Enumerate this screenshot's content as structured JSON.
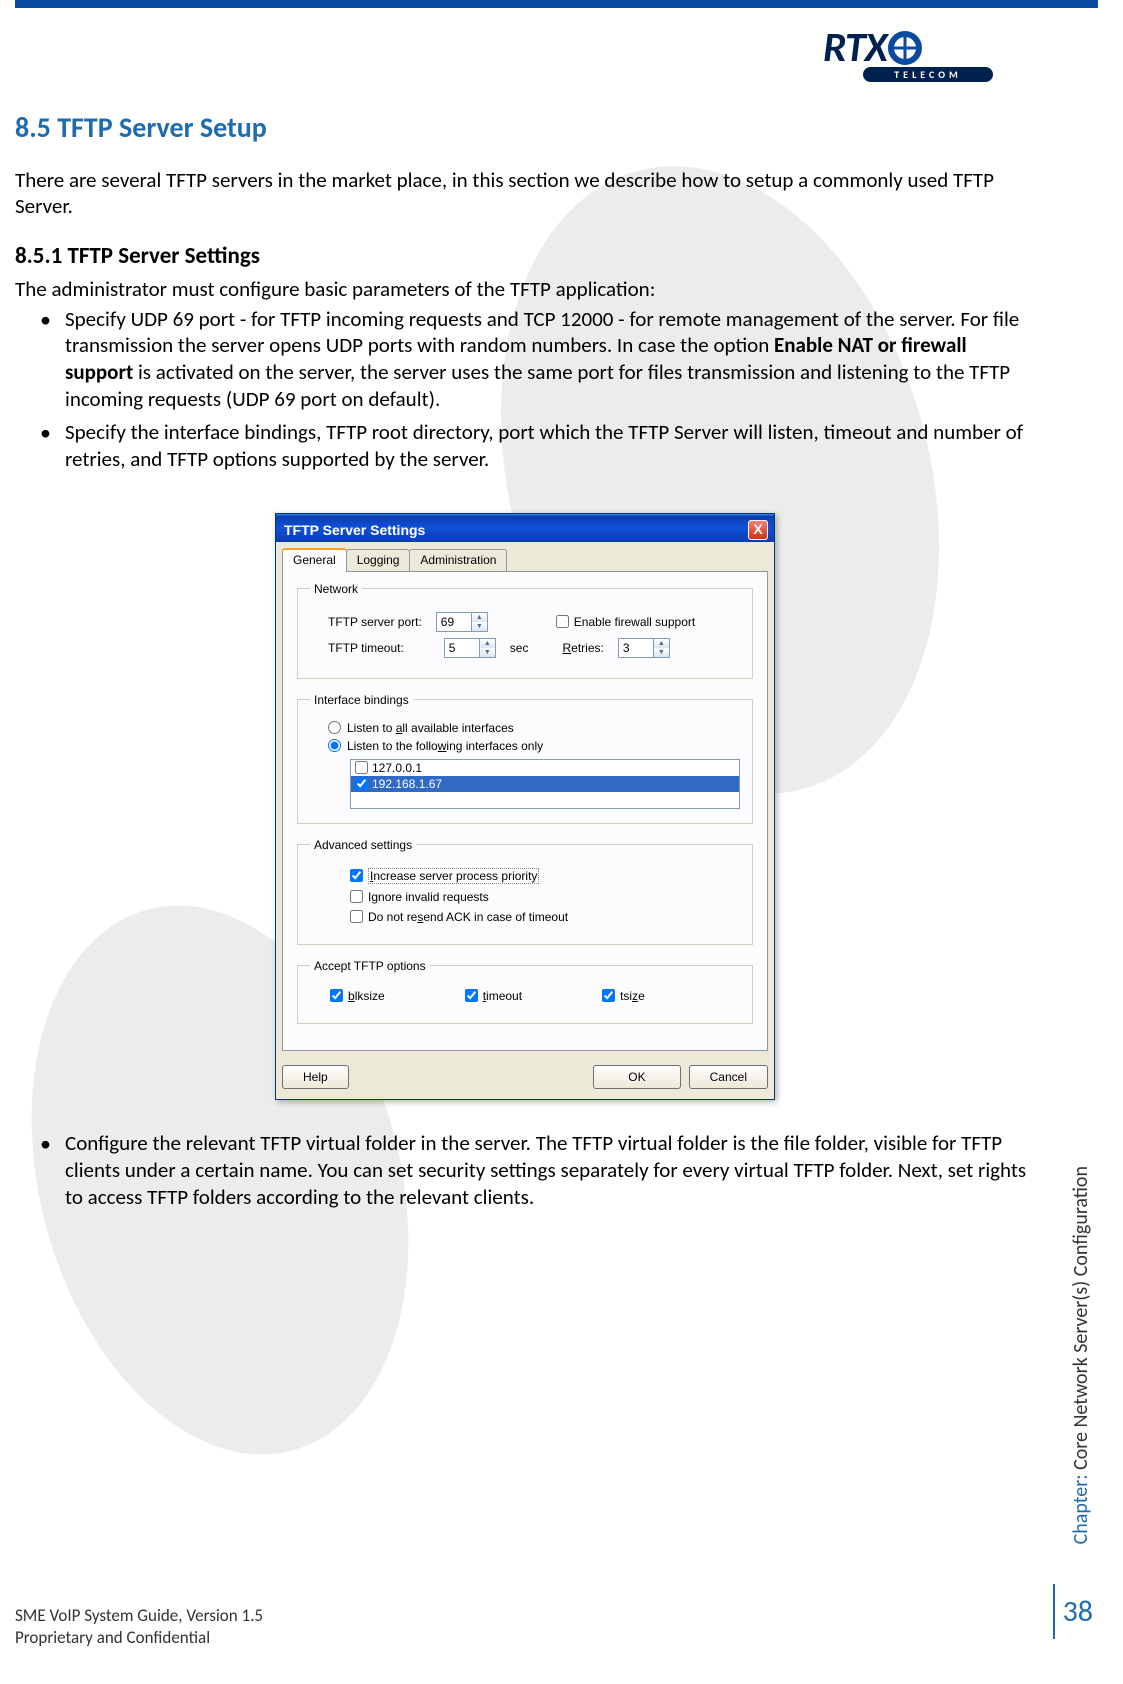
{
  "header": {
    "logo_text": "RTX",
    "logo_sub": "TELECOM"
  },
  "section": {
    "h1": "8.5 TFTP Server Setup",
    "intro": "There are several TFTP servers in the market place, in this section we describe how to setup a commonly used TFTP Server.",
    "h2": "8.5.1   TFTP Server Settings",
    "sub": "The administrator must configure basic parameters of the TFTP application:",
    "bullets": [
      {
        "pre": "Specify UDP 69 port - for TFTP incoming requests and TCP 12000 - for remote management of the server. For file transmission the server opens UDP ports with random numbers. In case the option ",
        "bold": "Enable NAT or firewall support",
        "post": " is activated on the server, the server uses the same port for files transmission and listening to the TFTP incoming requests (UDP 69 port on default)."
      },
      {
        "pre": "Specify the interface bindings, TFTP root directory, port which the TFTP Server will listen, timeout and number of retries, and TFTP options supported by the server.",
        "bold": "",
        "post": ""
      }
    ],
    "bullet_after": "Configure the relevant TFTP virtual folder in the server. The TFTP virtual folder is the file folder, visible for TFTP clients under a certain name. You can set security settings separately for every virtual TFTP folder. Next, set rights to access TFTP folders according to the relevant clients."
  },
  "dialog": {
    "title": "TFTP Server Settings",
    "close": "X",
    "tabs": [
      "General",
      "Logging",
      "Administration"
    ],
    "group_network": "Network",
    "lbl_port": "TFTP server port:",
    "val_port": "69",
    "cb_firewall": "Enable firewall support",
    "lbl_timeout": "TFTP timeout:",
    "val_timeout": "5",
    "sec": "sec",
    "lbl_retries": "Retries:",
    "val_retries": "3",
    "group_if": "Interface bindings",
    "radio_all": "Listen to all available interfaces",
    "radio_follow": "Listen to the following interfaces only",
    "ip1": "127.0.0.1",
    "ip2": "192.168.1.67",
    "group_adv": "Advanced settings",
    "cb_increase": "Increase server process priority",
    "cb_ignore": "Ignore invalid requests",
    "cb_noresend": "Do not resend ACK in case of timeout",
    "group_accept": "Accept TFTP options",
    "cb_blksize": "blksize",
    "cb_timeopt": "timeout",
    "cb_tsize": "tsize",
    "btn_help": "Help",
    "btn_ok": "OK",
    "btn_cancel": "Cancel"
  },
  "side": {
    "pre": "Chapter:",
    "text": " Core Network Server(s) Configuration"
  },
  "footer": {
    "l1": "SME VoIP System Guide, Version 1.5",
    "l2": "Proprietary and Confidential"
  },
  "page_number": "38"
}
